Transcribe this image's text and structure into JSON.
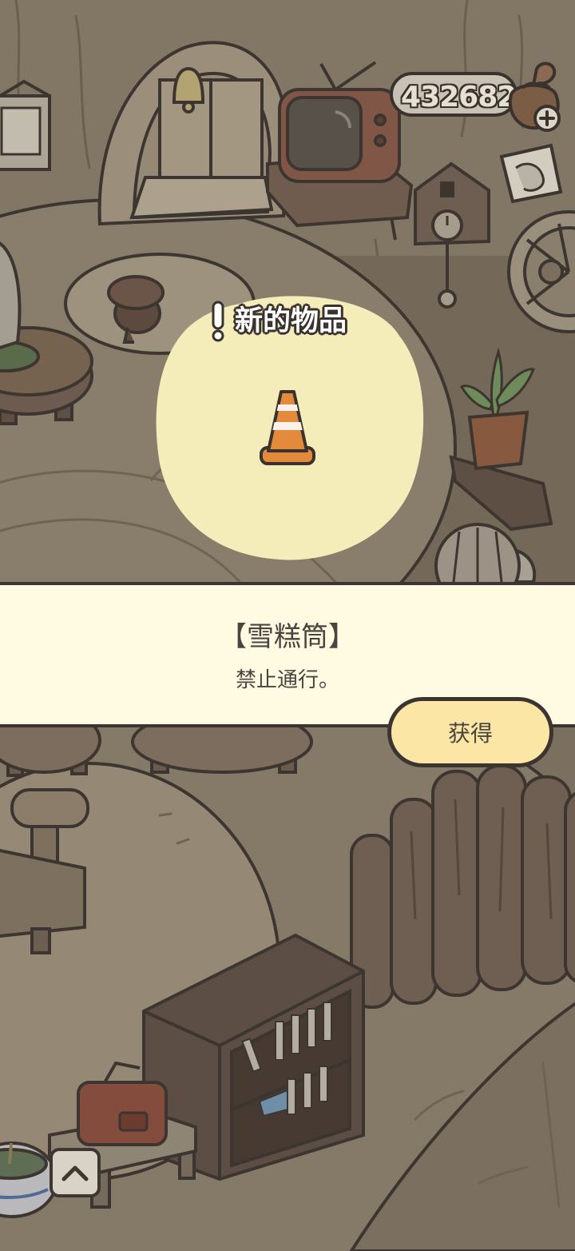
{
  "currency": {
    "amount": "432682",
    "icon": "clover-pouch-icon",
    "add_icon": "plus-icon"
  },
  "new_item_popup": {
    "header_icon": "exclamation-icon",
    "header_label": "新的物品",
    "item_icon": "traffic-cone-icon"
  },
  "item_info": {
    "name": "【雪糕筒】",
    "description": "禁止通行。"
  },
  "actions": {
    "obtain_label": "获得"
  },
  "bottom_nav": {
    "expand_icon": "chevron-up-icon"
  },
  "colors": {
    "banner_background": "#fffbe3",
    "button_background": "#fbe6a6",
    "popup_blob": "#f4edba",
    "cone_orange": "#e38a3c",
    "outline": "#3b3430"
  }
}
